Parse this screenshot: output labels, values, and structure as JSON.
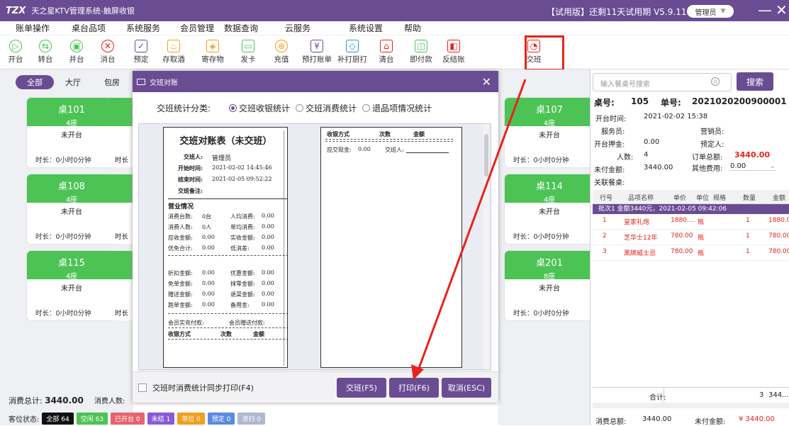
{
  "titlebar": {
    "logo": "TZX",
    "title": "天之星KTV管理系统-触屏收银",
    "trial": "【试用版】还剩11天试用期 V5.9.11.19",
    "user": "管理员",
    "minimize": "—",
    "close": "✕"
  },
  "menu": [
    "账单操作",
    "桌台品项",
    "系统服务",
    "会员管理",
    "数据查询",
    "云服务",
    "系统设置",
    "帮助"
  ],
  "toolbar": [
    {
      "label": "开台",
      "icon": "▷",
      "color": "#4cc354"
    },
    {
      "label": "转台",
      "icon": "⇆",
      "color": "#4cc354"
    },
    {
      "label": "并台",
      "icon": "▣",
      "color": "#4cc354"
    },
    {
      "label": "消台",
      "icon": "✕",
      "color": "#e8231b"
    },
    {
      "label": "预定",
      "icon": "✓",
      "color": "#6a4c93"
    },
    {
      "label": "存取酒",
      "icon": "♨",
      "color": "#f0a020"
    },
    {
      "label": "寄存物",
      "icon": "◈",
      "color": "#f0a020"
    },
    {
      "label": "发卡",
      "icon": "▭",
      "color": "#4cc354"
    },
    {
      "label": "充值",
      "icon": "⊕",
      "color": "#f0a020"
    },
    {
      "label": "预打账单",
      "icon": "¥",
      "color": "#6a4c93"
    },
    {
      "label": "补打厨打",
      "icon": "◇",
      "color": "#1aa0c8"
    },
    {
      "label": "清台",
      "icon": "⌂",
      "color": "#e8231b"
    },
    {
      "label": "即付款",
      "icon": "◫",
      "color": "#4cc354"
    },
    {
      "label": "反结账",
      "icon": "◧",
      "color": "#e8231b"
    },
    {
      "label": "交班",
      "icon": "◔",
      "color": "#e8231b"
    }
  ],
  "area_tabs": [
    "全部",
    "大厅",
    "包房"
  ],
  "tables": [
    {
      "name": "桌101",
      "seats": "4座",
      "status": "未开台",
      "duration": "时长：0小时0分钟"
    },
    {
      "name": "桌107",
      "seats": "4座",
      "status": "未开台",
      "duration": "时长：0小时0分钟"
    },
    {
      "name": "桌108",
      "seats": "4座",
      "status": "未开台",
      "duration": "时长：0小时0分钟"
    },
    {
      "name": "桌114",
      "seats": "4座",
      "status": "未开台",
      "duration": "时长：0小时0分钟"
    },
    {
      "name": "桌115",
      "seats": "4座",
      "status": "未开台",
      "duration": "时长：0小时0分钟"
    },
    {
      "name": "桌201",
      "seats": "8座",
      "status": "未开台",
      "duration": "时长：0小时0分钟"
    }
  ],
  "partial_duration": "时长",
  "footer_left": {
    "total_label": "消费总计:",
    "total_value": "3440.00",
    "people_label": "消费人数:",
    "legend_label": "客位状态:",
    "legend": [
      {
        "label": "全部 64",
        "color": "#111"
      },
      {
        "label": "空闲 63",
        "color": "#4cc354"
      },
      {
        "label": "已开台 0",
        "color": "#e8646c"
      },
      {
        "label": "未结 1",
        "color": "#8a5ad6"
      },
      {
        "label": "带位 0",
        "color": "#f0a020"
      },
      {
        "label": "预定 0",
        "color": "#5a8ae0"
      },
      {
        "label": "清扫 0",
        "color": "#b0b8d0"
      }
    ]
  },
  "dialog": {
    "title": "交班对账",
    "category_label": "交班统计分类:",
    "options": [
      {
        "label": "交班收银统计",
        "checked": true
      },
      {
        "label": "交班消费统计",
        "checked": false
      },
      {
        "label": "退品项情况统计",
        "checked": false
      }
    ],
    "receipt": {
      "title": "交班对账表（未交班）",
      "handover_label": "交班人:",
      "handover_value": "管理员",
      "start_label": "开始时间:",
      "start_value": "2021-02-02 14:45:46",
      "end_label": "结束时间:",
      "end_value": "2021-02-05 09:52:22",
      "note_label": "交班备注:",
      "section": "营业情况",
      "rows": [
        [
          "消费台数:",
          "0台",
          "人均消费:",
          "0.00"
        ],
        [
          "消费人数:",
          "0人",
          "单均消费:",
          "0.00"
        ],
        [
          "应收金额:",
          "0.00",
          "实收金额:",
          "0.00"
        ],
        [
          "优免合计:",
          "0.00",
          "低消差:",
          "0.00"
        ]
      ],
      "rows2": [
        [
          "折扣金额:",
          "0.00",
          "优惠金额:",
          "0.00"
        ],
        [
          "免单金额:",
          "0.00",
          "抹零金额:",
          "0.00"
        ],
        [
          "赠送金额:",
          "0.00",
          "退菜金额:",
          "0.00"
        ],
        [
          "跑单金额:",
          "0.00",
          "备用金:",
          "0.00"
        ]
      ],
      "member_actual": "会员实充付款:",
      "member_gift": "会员赠送付款:",
      "pay_method": "收银方式",
      "count": "次数",
      "amount": "金额"
    },
    "receipt2": {
      "pay_method": "收银方式",
      "count": "次数",
      "amount": "金额",
      "cash_label": "应交现金:",
      "cash_value": "0.00",
      "handover": "交班人:"
    },
    "sync_print": "交班时消费统计同步打印(F4)",
    "btn_handover": "交班(F5)",
    "btn_print": "打印(F6)",
    "btn_cancel": "取消(ESC)"
  },
  "right": {
    "search_placeholder": "输入餐桌号搜索",
    "search_btn": "搜索",
    "table_label": "桌号:",
    "table_value": "105",
    "order_label": "单号:",
    "order_value": "2021020200900001",
    "open_time_label": "开台时间:",
    "open_time_value": "2021-02-02 15:38",
    "waiter_label": "服务员:",
    "sales_label": "营销员:",
    "deposit_label": "开台押金:",
    "deposit_value": "0.00",
    "booker_label": "预定人:",
    "people_label": "人数:",
    "people_value": "4",
    "order_total_label": "订单总额:",
    "order_total_value": "3440.00",
    "unpaid_label": "未付金额:",
    "unpaid_value": "3440.00",
    "other_label": "其他费用:",
    "other_value": "0.00",
    "linked_label": "关联餐桌:",
    "columns": [
      "行号",
      "品项名称",
      "单价",
      "单位",
      "规格",
      "数量",
      "金额"
    ],
    "batch": "批次1  金额3440元，2021-02-05 09:42:06",
    "items": [
      {
        "no": "1",
        "name": "皇家礼炮",
        "price": "1880....",
        "unit": "瓶",
        "qty": "1",
        "amount": "1880.00"
      },
      {
        "no": "2",
        "name": "芝华士12年",
        "price": "780.00",
        "unit": "瓶",
        "qty": "1",
        "amount": "780.00"
      },
      {
        "no": "3",
        "name": "黑牌威士忌",
        "price": "780.00",
        "unit": "瓶",
        "qty": "1",
        "amount": "780.00"
      }
    ],
    "total_label": "合计:",
    "total_qty": "3",
    "total_amount": "344...",
    "foot_total_label": "消费总额:",
    "foot_total_value": "3440.00",
    "foot_unpaid_label": "未付金额:",
    "foot_unpaid_value": "¥ 3440.00"
  },
  "accent": "#6a4c93",
  "green": "#4cc354",
  "red": "#e8231b"
}
